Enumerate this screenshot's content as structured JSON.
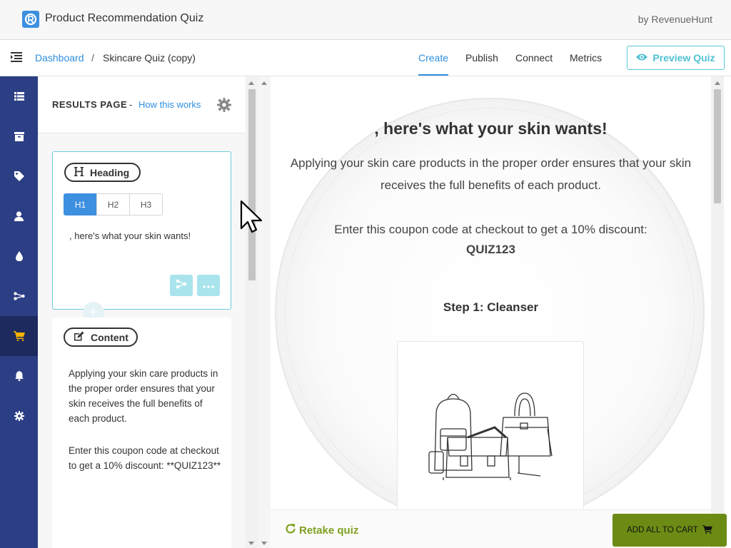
{
  "app": {
    "title": "Product Recommendation Quiz",
    "byline": "by RevenueHunt"
  },
  "breadcrumb": {
    "root": "Dashboard",
    "separator": "/",
    "current": "Skincare Quiz (copy)"
  },
  "tabs": [
    {
      "label": "Create",
      "active": true
    },
    {
      "label": "Publish",
      "active": false
    },
    {
      "label": "Connect",
      "active": false
    },
    {
      "label": "Metrics",
      "active": false
    }
  ],
  "preview_button": {
    "label": "Preview Quiz",
    "icon": "eye-icon"
  },
  "sidebar": {
    "items": [
      {
        "icon": "list-icon"
      },
      {
        "icon": "box-icon"
      },
      {
        "icon": "tag-icon"
      },
      {
        "icon": "user-icon"
      },
      {
        "icon": "drop-icon"
      },
      {
        "icon": "flow-icon"
      },
      {
        "icon": "cart-icon",
        "active": true
      },
      {
        "icon": "bell-icon"
      },
      {
        "icon": "gear-icon"
      }
    ]
  },
  "panel": {
    "title": "RESULTS PAGE",
    "dash": "-",
    "help_link": "How this works",
    "heading_block": {
      "label": "Heading",
      "levels": [
        "H1",
        "H2",
        "H3"
      ],
      "selected": "H1",
      "value": ", here's what your skin wants!"
    },
    "content_block": {
      "label": "Content",
      "paragraph1": "Applying your skin care products in the proper order ensures that your skin receives the full benefits of each product.",
      "paragraph2": "Enter this coupon code at checkout to get a 10% discount: **QUIZ123**"
    }
  },
  "preview": {
    "heading": ", here's what your skin wants!",
    "body": "Applying your skin care products in the proper order ensures that your skin receives the full benefits of each product.",
    "coupon_text": "Enter this coupon code at checkout to get a 10% discount:",
    "coupon_code": "QUIZ123",
    "step_title": "Step 1: Cleanser",
    "retake_label": "Retake quiz",
    "add_all_label": "ADD ALL TO CART"
  },
  "colors": {
    "accent": "#2f8fe0",
    "sidebar": "#2c3e84",
    "sidebar_active": "#1d2a5e",
    "active_icon": "#f5b400",
    "teal": "#4fc1d3",
    "retake": "#7fa020",
    "cart_button": "#6c8b14"
  }
}
